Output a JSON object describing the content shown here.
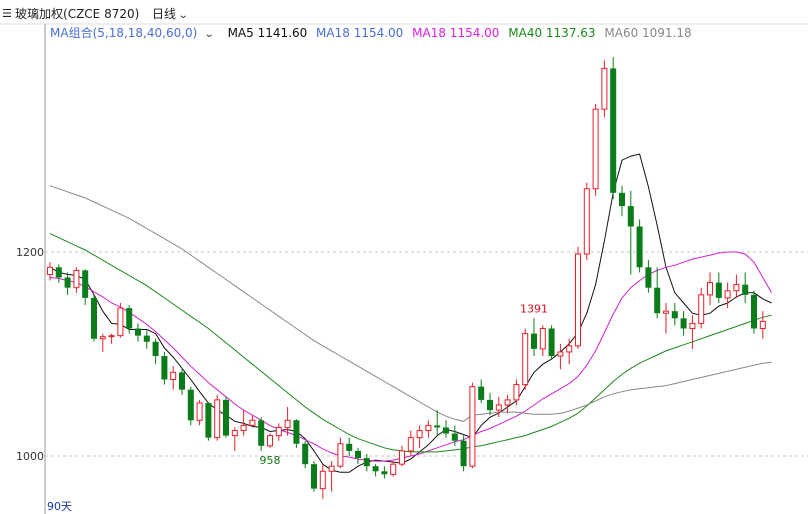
{
  "header": {
    "instrument_name": "玻璃加权",
    "instrument_code": "(CZCE 8720)",
    "period": "日线",
    "menu_icon": "list-icon",
    "dropdown_icon": "chevron-down-icon"
  },
  "ma_legend": {
    "group_label": "MA组合(5,18,18,40,60,0)",
    "items": [
      {
        "label": "MA5 1141.60",
        "color": "#111111"
      },
      {
        "label": "MA18 1154.00",
        "color": "#4a6fd6"
      },
      {
        "label": "MA18 1154.00",
        "color": "#e020e0"
      },
      {
        "label": "MA40 1137.63",
        "color": "#1a8a1a"
      },
      {
        "label": "MA60 1091.18",
        "color": "#888888"
      }
    ]
  },
  "footer": {
    "range_label": "90天"
  },
  "colors": {
    "up": "#e8202a",
    "down": "#0a7d1a",
    "grid": "#c8c8c8",
    "axis": "#999999"
  },
  "chart_data": {
    "type": "candlestick",
    "y_ticks": [
      1000,
      1200
    ],
    "grid": "dashed horizontal",
    "annotations": [
      {
        "label": "1391",
        "index": 55,
        "kind": "high",
        "color": "#d0101a"
      },
      {
        "label": "958",
        "index": 25,
        "kind": "low",
        "color": "#1a7a1a"
      }
    ],
    "candles": [
      [
        1178,
        1190,
        1172,
        1185
      ],
      [
        1185,
        1188,
        1170,
        1175
      ],
      [
        1175,
        1180,
        1158,
        1165
      ],
      [
        1165,
        1185,
        1160,
        1182
      ],
      [
        1182,
        1183,
        1148,
        1155
      ],
      [
        1155,
        1158,
        1112,
        1115
      ],
      [
        1115,
        1120,
        1102,
        1117
      ],
      [
        1117,
        1120,
        1110,
        1118
      ],
      [
        1118,
        1150,
        1116,
        1145
      ],
      [
        1145,
        1148,
        1120,
        1125
      ],
      [
        1125,
        1130,
        1112,
        1118
      ],
      [
        1118,
        1123,
        1105,
        1112
      ],
      [
        1112,
        1115,
        1090,
        1098
      ],
      [
        1098,
        1102,
        1070,
        1075
      ],
      [
        1075,
        1088,
        1065,
        1082
      ],
      [
        1082,
        1085,
        1060,
        1065
      ],
      [
        1065,
        1068,
        1030,
        1035
      ],
      [
        1035,
        1055,
        1030,
        1052
      ],
      [
        1052,
        1053,
        1015,
        1018
      ],
      [
        1018,
        1060,
        1015,
        1055
      ],
      [
        1055,
        1058,
        1018,
        1020
      ],
      [
        1020,
        1028,
        1005,
        1025
      ],
      [
        1025,
        1045,
        1020,
        1030
      ],
      [
        1030,
        1040,
        1028,
        1035
      ],
      [
        1035,
        1038,
        1005,
        1010
      ],
      [
        1010,
        1022,
        1008,
        1020
      ],
      [
        1020,
        1032,
        1015,
        1028
      ],
      [
        1028,
        1048,
        1020,
        1035
      ],
      [
        1035,
        1036,
        1008,
        1012
      ],
      [
        1012,
        1015,
        988,
        992
      ],
      [
        992,
        995,
        965,
        968
      ],
      [
        968,
        992,
        958,
        985
      ],
      [
        985,
        995,
        965,
        990
      ],
      [
        990,
        1018,
        988,
        1012
      ],
      [
        1012,
        1018,
        1000,
        1005
      ],
      [
        1005,
        1008,
        992,
        998
      ],
      [
        998,
        1002,
        985,
        990
      ],
      [
        990,
        992,
        980,
        985
      ],
      [
        985,
        990,
        978,
        982
      ],
      [
        982,
        995,
        980,
        992
      ],
      [
        992,
        1010,
        990,
        1005
      ],
      [
        1005,
        1025,
        1000,
        1018
      ],
      [
        1018,
        1030,
        1008,
        1025
      ],
      [
        1025,
        1035,
        1018,
        1030
      ],
      [
        1030,
        1045,
        1020,
        1028
      ],
      [
        1028,
        1035,
        1018,
        1022
      ],
      [
        1022,
        1030,
        1010,
        1015
      ],
      [
        1015,
        1020,
        985,
        990
      ],
      [
        990,
        1072,
        988,
        1068
      ],
      [
        1068,
        1075,
        1052,
        1055
      ],
      [
        1055,
        1062,
        1040,
        1045
      ],
      [
        1045,
        1058,
        1038,
        1050
      ],
      [
        1050,
        1060,
        1042,
        1055
      ],
      [
        1055,
        1075,
        1050,
        1070
      ],
      [
        1070,
        1125,
        1065,
        1120
      ],
      [
        1120,
        1135,
        1098,
        1105
      ],
      [
        1105,
        1128,
        1098,
        1125
      ],
      [
        1125,
        1128,
        1095,
        1098
      ],
      [
        1098,
        1110,
        1085,
        1102
      ],
      [
        1102,
        1115,
        1090,
        1108
      ],
      [
        1108,
        1205,
        1105,
        1198
      ],
      [
        1198,
        1268,
        1192,
        1262
      ],
      [
        1262,
        1345,
        1255,
        1340
      ],
      [
        1340,
        1388,
        1332,
        1380
      ],
      [
        1380,
        1391,
        1252,
        1258
      ],
      [
        1258,
        1265,
        1235,
        1245
      ],
      [
        1245,
        1260,
        1178,
        1225
      ],
      [
        1225,
        1232,
        1180,
        1185
      ],
      [
        1185,
        1192,
        1160,
        1165
      ],
      [
        1165,
        1185,
        1135,
        1140
      ],
      [
        1140,
        1150,
        1120,
        1142
      ],
      [
        1142,
        1150,
        1128,
        1135
      ],
      [
        1135,
        1142,
        1118,
        1125
      ],
      [
        1125,
        1138,
        1105,
        1130
      ],
      [
        1130,
        1165,
        1125,
        1158
      ],
      [
        1158,
        1180,
        1148,
        1170
      ],
      [
        1170,
        1180,
        1150,
        1155
      ],
      [
        1155,
        1170,
        1145,
        1162
      ],
      [
        1162,
        1178,
        1155,
        1168
      ],
      [
        1168,
        1180,
        1150,
        1158
      ],
      [
        1158,
        1162,
        1120,
        1125
      ],
      [
        1125,
        1142,
        1115,
        1132
      ]
    ],
    "ma_series": [
      {
        "name": "MA5",
        "color": "#111111",
        "values": [
          1185,
          1180,
          1178,
          1177,
          1173,
          1158,
          1142,
          1130,
          1129,
          1124,
          1124,
          1124,
          1120,
          1106,
          1097,
          1086,
          1075,
          1063,
          1052,
          1045,
          1040,
          1034,
          1032,
          1029,
          1028,
          1024,
          1025,
          1026,
          1024,
          1017,
          1005,
          992,
          986,
          984,
          984,
          990,
          994,
          996,
          995,
          994,
          993,
          997,
          1004,
          1011,
          1020,
          1026,
          1024,
          1021,
          1018,
          1030,
          1038,
          1042,
          1048,
          1054,
          1068,
          1082,
          1090,
          1095,
          1102,
          1110,
          1121,
          1140,
          1168,
          1211,
          1258,
          1290,
          1294,
          1296,
          1264,
          1226,
          1185,
          1160,
          1150,
          1140,
          1138,
          1140,
          1147,
          1150,
          1156,
          1160,
          1160,
          1154,
          1150
        ]
      },
      {
        "name": "MA18",
        "color": "#d020d0",
        "values": [
          1175,
          1174,
          1172,
          1170,
          1166,
          1161,
          1156,
          1150,
          1146,
          1141,
          1135,
          1129,
          1122,
          1114,
          1106,
          1097,
          1088,
          1080,
          1072,
          1065,
          1058,
          1051,
          1045,
          1040,
          1035,
          1030,
          1026,
          1023,
          1020,
          1016,
          1012,
          1007,
          1003,
          1000,
          999,
          997,
          996,
          995,
          995,
          996,
          998,
          1000,
          1002,
          1005,
          1008,
          1011,
          1014,
          1016,
          1020,
          1024,
          1027,
          1031,
          1035,
          1039,
          1044,
          1050,
          1056,
          1061,
          1066,
          1071,
          1078,
          1089,
          1103,
          1121,
          1139,
          1155,
          1165,
          1172,
          1178,
          1182,
          1185,
          1187,
          1190,
          1193,
          1195,
          1197,
          1199,
          1200,
          1200,
          1198,
          1190,
          1175,
          1160
        ]
      },
      {
        "name": "MA40",
        "color": "#1a8a1a",
        "values": [
          1218,
          1214,
          1210,
          1206,
          1202,
          1197,
          1192,
          1187,
          1182,
          1177,
          1172,
          1167,
          1161,
          1155,
          1149,
          1143,
          1137,
          1131,
          1125,
          1118,
          1111,
          1104,
          1097,
          1090,
          1083,
          1076,
          1069,
          1062,
          1055,
          1048,
          1042,
          1036,
          1031,
          1026,
          1021,
          1017,
          1014,
          1011,
          1008,
          1006,
          1005,
          1004,
          1004,
          1004,
          1004,
          1005,
          1006,
          1007,
          1009,
          1010,
          1012,
          1014,
          1016,
          1018,
          1020,
          1023,
          1026,
          1029,
          1033,
          1037,
          1042,
          1049,
          1057,
          1065,
          1073,
          1080,
          1086,
          1091,
          1095,
          1099,
          1103,
          1106,
          1109,
          1112,
          1115,
          1118,
          1121,
          1124,
          1127,
          1130,
          1133,
          1136,
          1138
        ]
      },
      {
        "name": "MA60",
        "color": "#888888",
        "values": [
          1265,
          1262,
          1259,
          1256,
          1253,
          1249,
          1245,
          1241,
          1237,
          1233,
          1228,
          1223,
          1218,
          1213,
          1208,
          1203,
          1197,
          1191,
          1185,
          1179,
          1173,
          1167,
          1161,
          1155,
          1149,
          1143,
          1137,
          1131,
          1125,
          1119,
          1113,
          1108,
          1103,
          1098,
          1093,
          1088,
          1083,
          1078,
          1073,
          1068,
          1063,
          1058,
          1053,
          1048,
          1043,
          1039,
          1036,
          1034,
          1040,
          1041,
          1042,
          1043,
          1043,
          1043,
          1042,
          1041,
          1041,
          1041,
          1042,
          1044,
          1047,
          1050,
          1054,
          1058,
          1061,
          1063,
          1065,
          1066,
          1067,
          1068,
          1069,
          1071,
          1073,
          1075,
          1077,
          1079,
          1081,
          1083,
          1085,
          1087,
          1089,
          1091,
          1092
        ]
      }
    ]
  }
}
